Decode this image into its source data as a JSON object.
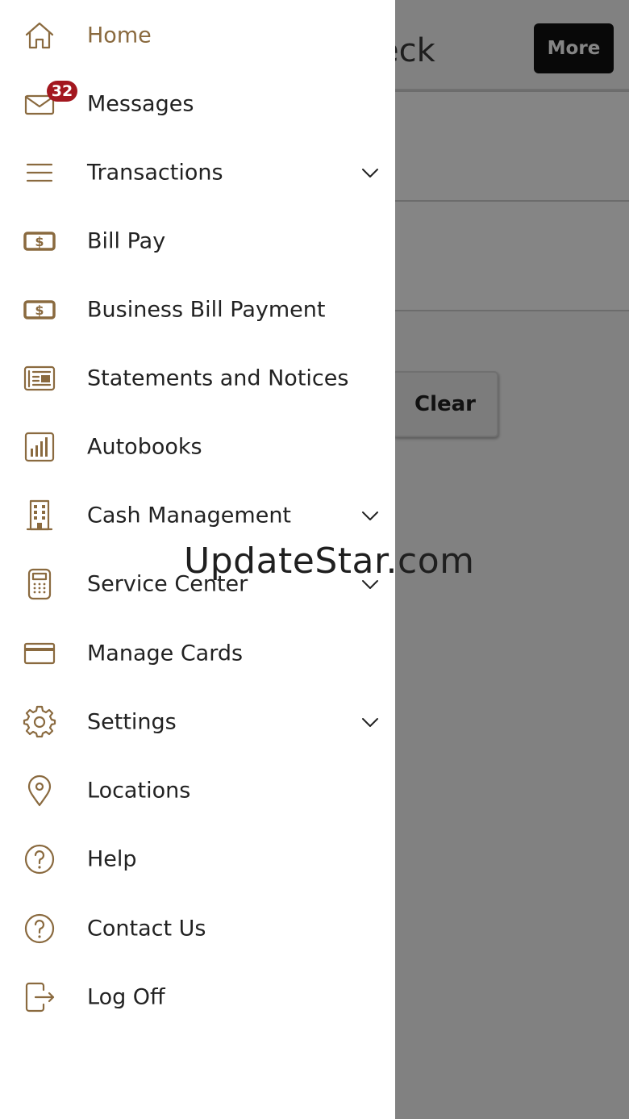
{
  "background": {
    "title_fragment": "eck",
    "more_label": "More",
    "clear_label": "Clear"
  },
  "menu": {
    "items": [
      {
        "label": "Home",
        "icon": "home-icon",
        "active": true
      },
      {
        "label": "Messages",
        "icon": "envelope-icon",
        "badge": "32"
      },
      {
        "label": "Transactions",
        "icon": "list-icon",
        "expandable": true
      },
      {
        "label": "Bill Pay",
        "icon": "dollar-bill-icon"
      },
      {
        "label": "Business Bill Payment",
        "icon": "dollar-bill-icon"
      },
      {
        "label": "Statements and Notices",
        "icon": "newspaper-icon"
      },
      {
        "label": "Autobooks",
        "icon": "bar-chart-icon"
      },
      {
        "label": "Cash Management",
        "icon": "building-icon",
        "expandable": true
      },
      {
        "label": "Service Center",
        "icon": "calculator-icon",
        "expandable": true
      },
      {
        "label": "Manage Cards",
        "icon": "credit-card-icon"
      },
      {
        "label": "Settings",
        "icon": "gear-icon",
        "expandable": true
      },
      {
        "label": "Locations",
        "icon": "map-pin-icon"
      },
      {
        "label": "Help",
        "icon": "question-circle-icon"
      },
      {
        "label": "Contact Us",
        "icon": "question-circle-icon"
      },
      {
        "label": "Log Off",
        "icon": "logout-icon"
      }
    ]
  },
  "watermark": "UpdateStar.com",
  "colors": {
    "accent": "#8a6a3f",
    "badge": "#a3171f",
    "overlay": "#808080"
  }
}
